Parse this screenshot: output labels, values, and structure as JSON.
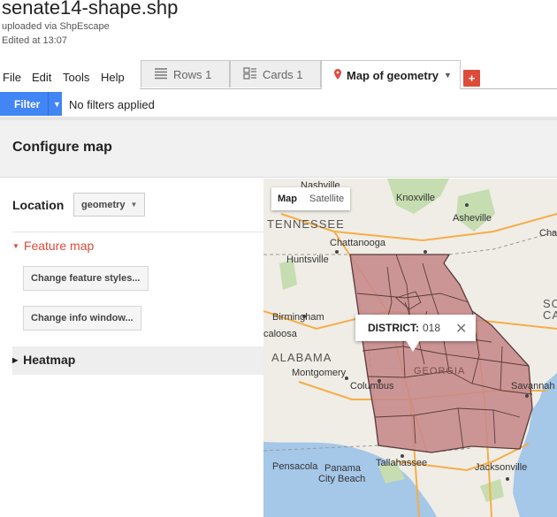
{
  "doc": {
    "title": "senate14-shape.shp",
    "uploaded": "uploaded via ShpEscape",
    "edited": "Edited at 13:07"
  },
  "menu": [
    "File",
    "Edit",
    "Tools",
    "Help"
  ],
  "tabs": [
    {
      "label": "Rows 1",
      "icon": "rows-icon"
    },
    {
      "label": "Cards 1",
      "icon": "cards-icon"
    },
    {
      "label": "Map of geometry",
      "icon": "map-pin-icon"
    }
  ],
  "add_tab": "+",
  "filter": {
    "button": "Filter",
    "status": "No filters applied"
  },
  "configure": {
    "title": "Configure map",
    "location_label": "Location",
    "location_value": "geometry",
    "feature_map": "Feature map",
    "change_styles": "Change feature styles...",
    "change_info": "Change info window...",
    "heatmap": "Heatmap"
  },
  "map": {
    "type_map": "Map",
    "type_satellite": "Satellite",
    "info_key": "DISTRICT:",
    "info_value": "018",
    "labels": {
      "nashville": "Nashville",
      "knoxville": "Knoxville",
      "asheville": "Asheville",
      "tennessee": "TENNESSEE",
      "charlotte": "Charlott",
      "chattanooga": "Chattanooga",
      "huntsville": "Huntsville",
      "south": "SOU",
      "carolina": "CARO",
      "birmingham": "Birmingham",
      "tuscaloosa": "caloosa",
      "alabama": "ALABAMA",
      "montgomery": "Montgomery",
      "columbus": "Columbus",
      "georgia": "GEORGIA",
      "savannah": "Savannah",
      "pensacola": "Pensacola",
      "tallahassee": "Tallahassee",
      "jacksonville": "Jacksonville",
      "panama": "Panama",
      "city_beach": "City Beach"
    },
    "colors": {
      "water": "#a5c7e8",
      "land": "#efede6",
      "park": "#c5ddb0",
      "district_fill": "#c7898a",
      "district_line": "#5b3a3a",
      "road": "#f6ad48"
    }
  }
}
